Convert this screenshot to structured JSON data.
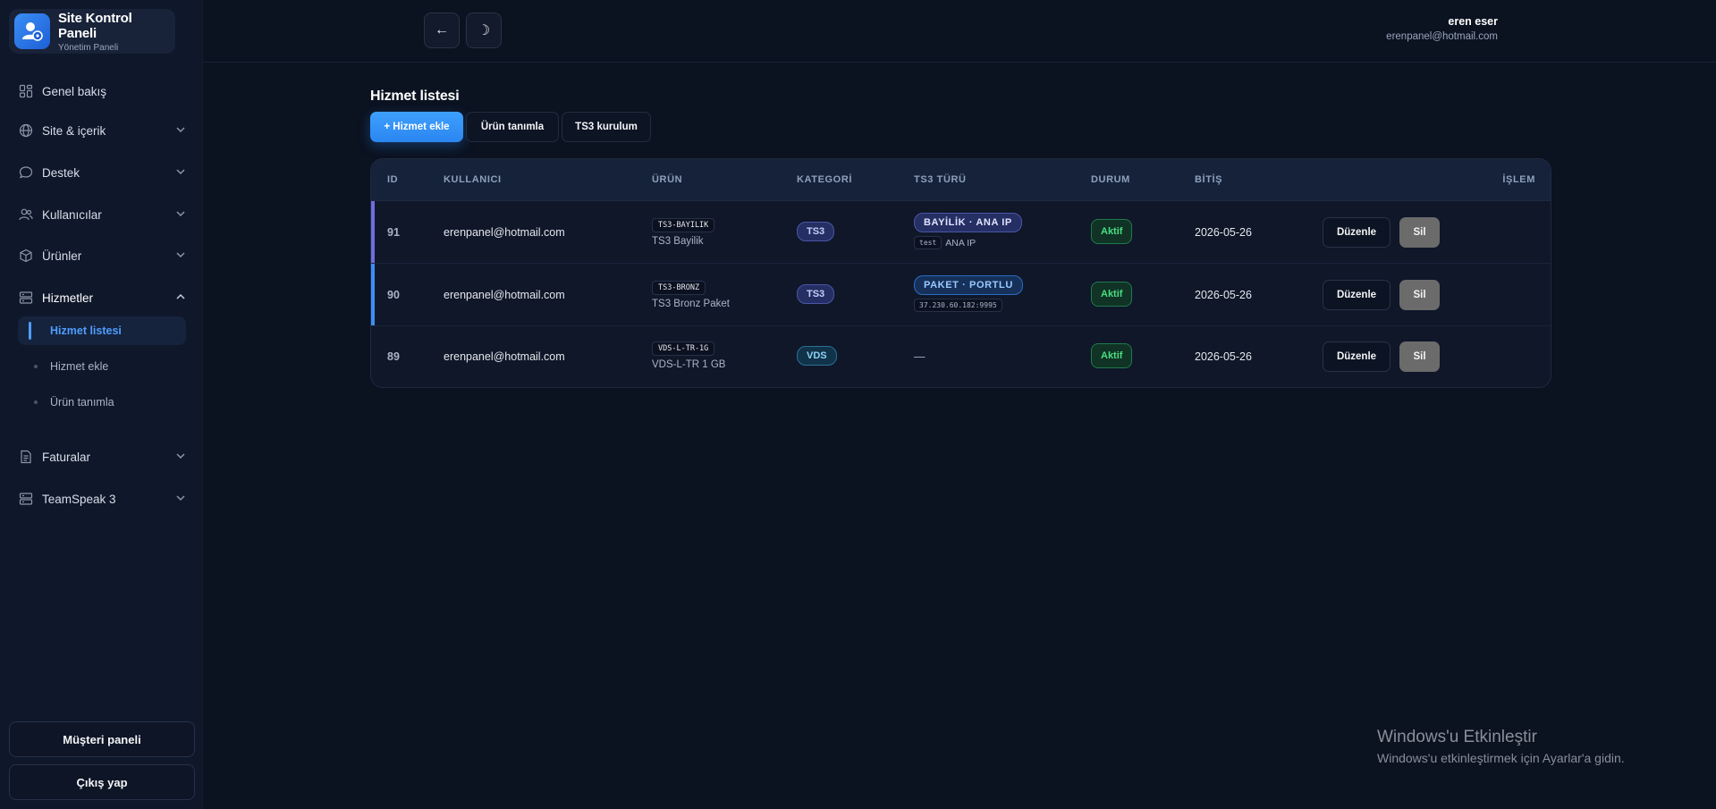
{
  "brand": {
    "title": "Site Kontrol Paneli",
    "subtitle": "Yönetim Paneli",
    "logo_icon": "user-gear-icon"
  },
  "sidebar": {
    "items": [
      {
        "label": "Genel bakış",
        "icon": "grid-icon"
      },
      {
        "label": "Site & içerik",
        "icon": "globe-icon"
      },
      {
        "label": "Destek",
        "icon": "chat-icon"
      },
      {
        "label": "Kullanıcılar",
        "icon": "users-icon"
      },
      {
        "label": "Ürünler",
        "icon": "box-icon"
      },
      {
        "label": "Hizmetler",
        "icon": "server-icon"
      },
      {
        "label": "Faturalar",
        "icon": "document-icon"
      },
      {
        "label": "TeamSpeak 3",
        "icon": "server-icon"
      }
    ],
    "sub_items": [
      {
        "label": "Hizmet listesi",
        "active": true
      },
      {
        "label": "Hizmet ekle",
        "active": false
      },
      {
        "label": "Ürün tanımla",
        "active": false
      }
    ],
    "customer_panel": "Müşteri paneli",
    "logout": "Çıkış yap"
  },
  "header": {
    "back_icon": "←",
    "theme_icon": "☽",
    "user_name": "eren eser",
    "user_email": "erenpanel@hotmail.com"
  },
  "main": {
    "title": "Hizmet listesi",
    "tabs": [
      "+ Hizmet ekle",
      "Ürün tanımla",
      "TS3 kurulum"
    ],
    "columns": [
      "ID",
      "KULLANICI",
      "ÜRÜN",
      "KATEGORİ",
      "TS3 TÜRÜ",
      "DURUM",
      "BİTİŞ",
      "İŞLEM"
    ],
    "rows": [
      {
        "id": "91",
        "user": "erenpanel@hotmail.com",
        "product_code": "TS3-BAYILIK",
        "product_name": "TS3 Bayilik",
        "category": "TS3",
        "ts3_type": "BAYİLİK · ANA IP",
        "ts3_code": "test",
        "ts3_note": "ANA IP",
        "status": "Aktif",
        "end_date": "2026-05-26",
        "edit": "Düzenle",
        "delete": "Sil"
      },
      {
        "id": "90",
        "user": "erenpanel@hotmail.com",
        "product_code": "TS3-BRONZ",
        "product_name": "TS3 Bronz Paket",
        "category": "TS3",
        "ts3_type": "PAKET · PORTLU",
        "ts3_code": "37.230.60.182:9995",
        "ts3_note": "",
        "status": "Aktif",
        "end_date": "2026-05-26",
        "edit": "Düzenle",
        "delete": "Sil"
      },
      {
        "id": "89",
        "user": "erenpanel@hotmail.com",
        "product_code": "VDS-L-TR-1G",
        "product_name": "VDS-L-TR 1 GB",
        "category": "VDS",
        "ts3_type": "—",
        "ts3_code": "",
        "ts3_note": "",
        "status": "Aktif",
        "end_date": "2026-05-26",
        "edit": "Düzenle",
        "delete": "Sil"
      }
    ]
  },
  "watermark": {
    "title": "Windows'u Etkinleştir",
    "subtitle": "Windows'u etkinleştirmek için Ayarlar'a gidin."
  },
  "colors": {
    "accent": "#3b8ef5",
    "row_accent_1": "#6f6de0",
    "row_accent_2": "#3b8ef5",
    "active_status": "#4ade80"
  }
}
